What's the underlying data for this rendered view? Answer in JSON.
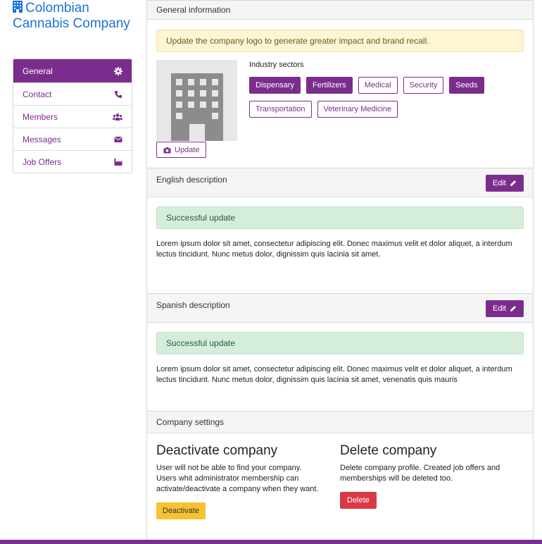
{
  "company": {
    "name": "Colombian Cannabis Company",
    "icon": "building-icon",
    "color": "#1a73d9"
  },
  "sidebar": {
    "items": [
      {
        "label": "General",
        "icon": "gear-icon",
        "active": true
      },
      {
        "label": "Contact",
        "icon": "phone-icon"
      },
      {
        "label": "Members",
        "icon": "users-icon"
      },
      {
        "label": "Messages",
        "icon": "envelope-icon"
      },
      {
        "label": "Job Offers",
        "icon": "factory-icon"
      }
    ]
  },
  "general": {
    "header": "General information",
    "logo_alert": "Update the company logo to generate greater impact and brand recall.",
    "update_label": "Update",
    "sectors_label": "Industry sectors",
    "sectors": [
      {
        "label": "Dispensary",
        "selected": true
      },
      {
        "label": "Fertilizers",
        "selected": true
      },
      {
        "label": "Medical",
        "selected": false
      },
      {
        "label": "Security",
        "selected": false
      },
      {
        "label": "Seeds",
        "selected": true
      },
      {
        "label": "Transportation",
        "selected": false
      },
      {
        "label": "Veterinary Medicine",
        "selected": false
      }
    ]
  },
  "english": {
    "header": "English description",
    "edit_label": "Edit",
    "alert": "Successful update",
    "text": "Lorem ipsum dolor sit amet, consectetur adipiscing elit. Donec maximus velit et dolor aliquet, a interdum lectus tincidunt. Nunc metus dolor, dignissim quis lacinia sit amet."
  },
  "spanish": {
    "header": "Spanish description",
    "edit_label": "Edit",
    "alert": "Successful update",
    "text": "Lorem ipsum dolor sit amet, consectetur adipiscing elit. Donec maximus velit et dolor aliquet, a interdum lectus tincidunt. Nunc metus dolor, dignissim quis lacinia sit amet, venenatis quis mauris"
  },
  "settings": {
    "header": "Company settings",
    "deactivate": {
      "title": "Deactivate company",
      "text": "User will not be able to find your company. Users whit administrator membership can activate/deactivate a company when they want.",
      "button": "Deactivate"
    },
    "delete": {
      "title": "Delete company",
      "text": "Delete company profile. Created job offers and memberships will be deleted too.",
      "button": "Delete"
    }
  },
  "colors": {
    "brand": "#7b2d8e",
    "warning": "#f6c231",
    "danger": "#d83a43",
    "success_bg": "#d5eedb",
    "warn_bg": "#fdf5d3"
  }
}
